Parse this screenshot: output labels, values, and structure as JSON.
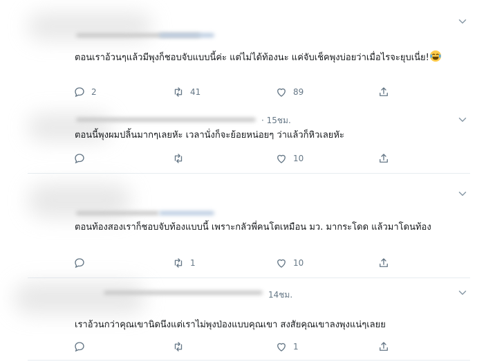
{
  "tweets": [
    {
      "time": "",
      "text": "ตอนเราอ้วนๆแล้วมีพุงก็ชอบจับแบบนี้ค่ะ แต่ไม่ได้ท้องนะ แค่จับเช็คพุงบ่อยว่าเมื่อไรจะยุบเนี่ย!",
      "emoji": "laughing-crying-emoji",
      "replies": "2",
      "retweets": "41",
      "likes": "89"
    },
    {
      "time": "· 15ชม.",
      "text": "ตอนนี้พุงผมปลิ้นมากๆเลยหัะ เวลานั่งก็จะย้อยหน่อยๆ ว่าแล้วก็หิวเลยหัะ",
      "replies": "",
      "retweets": "",
      "likes": "10"
    },
    {
      "time": "",
      "text": "ตอนท้องสองเราก็ชอบจับท้องแบบนี้ เพราะกลัวพี่คนโตเหมือน มว. มากระโดด แล้วมาโดนท้อง",
      "replies": "",
      "retweets": "1",
      "likes": "10"
    },
    {
      "time": "14ชม.",
      "text": "เราอ้วนกว่าคุณเขานิดนึงแต่เราไม่พุงป่องแบบคุณเขา สงสัยคุณเขาลงพุงแน่ๆเลยย",
      "replies": "",
      "retweets": "",
      "likes": "1"
    }
  ],
  "icons": {
    "reply": "reply-icon",
    "retweet": "retweet-icon",
    "like": "heart-icon",
    "share": "share-icon",
    "menu": "chevron-down-icon"
  },
  "colors": {
    "icon_gray": "#657786",
    "divider": "#e6ecf0",
    "text": "#14171a"
  }
}
